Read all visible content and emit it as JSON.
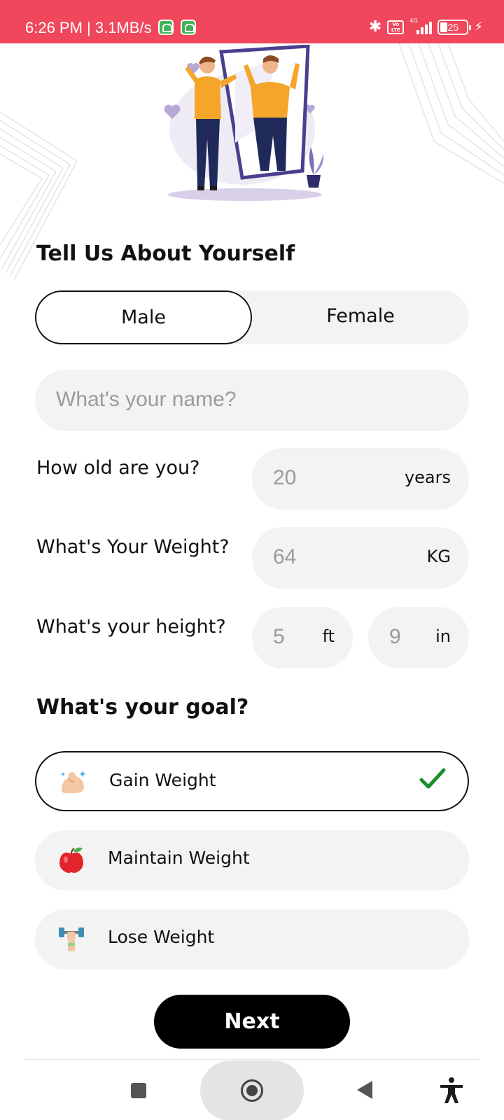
{
  "status_bar": {
    "time_speed": "6:26 PM | 3.1MB/s",
    "network": "4G",
    "volte": "Vo LTE",
    "battery": "25"
  },
  "profile": {
    "title": "Tell Us About Yourself",
    "gender": {
      "options": [
        "Male",
        "Female"
      ],
      "selected": "Male"
    },
    "name_placeholder": "What's your name?",
    "age": {
      "label": "How old are you?",
      "value": "20",
      "unit": "years"
    },
    "weight": {
      "label": "What's Your Weight?",
      "value": "64",
      "unit": "KG"
    },
    "height": {
      "label": "What's your height?",
      "feet": "5",
      "feet_unit": "ft",
      "inches": "9",
      "inches_unit": "in"
    }
  },
  "goal": {
    "title": "What's your goal?",
    "options": [
      {
        "label": "Gain Weight",
        "icon": "flexed-biceps-icon",
        "selected": true
      },
      {
        "label": "Maintain Weight",
        "icon": "apple-icon",
        "selected": false
      },
      {
        "label": "Lose Weight",
        "icon": "dumbbell-icon",
        "selected": false
      }
    ]
  },
  "next_label": "Next",
  "colors": {
    "status_bar": "#f0475c",
    "accent": "#000000",
    "check": "#1a8c2a",
    "field_bg": "#f3f3f3"
  }
}
